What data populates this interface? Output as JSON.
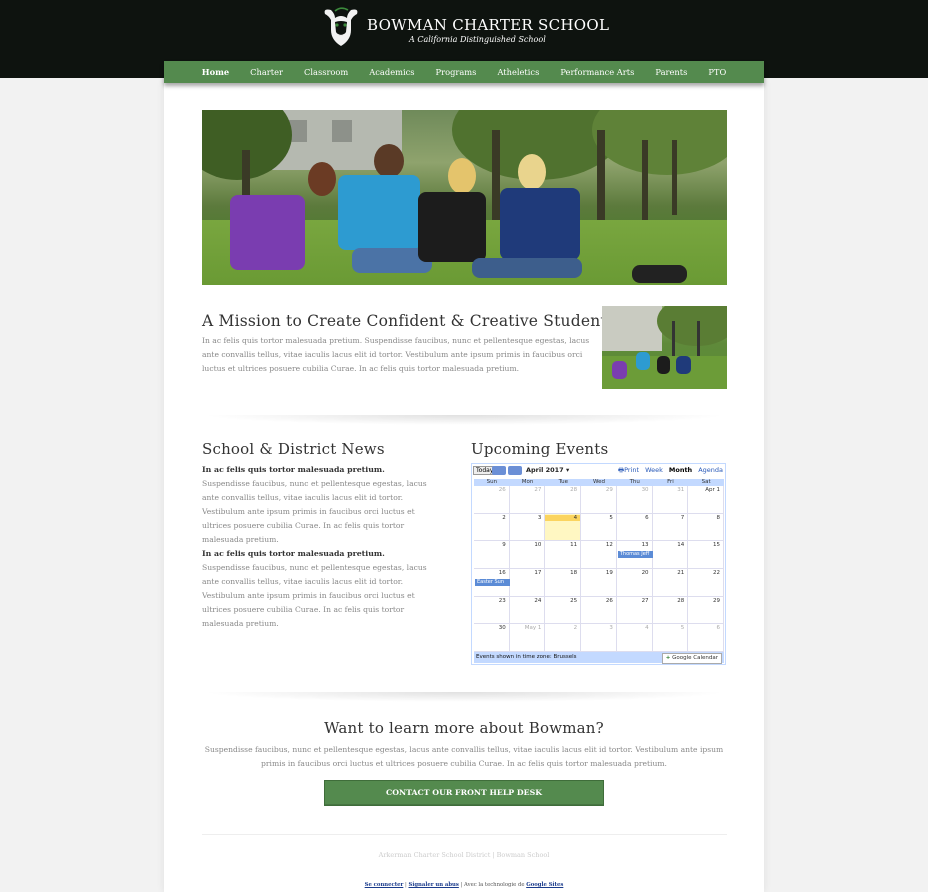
{
  "header": {
    "brand": "BOWMAN CHARTER SCHOOL",
    "tagline": "A California Distinguished School",
    "logo_icon": "bull-logo-icon"
  },
  "nav": {
    "items": [
      {
        "label": "Home"
      },
      {
        "label": "Charter"
      },
      {
        "label": "Classroom"
      },
      {
        "label": "Academics"
      },
      {
        "label": "Programs"
      },
      {
        "label": "Atheletics"
      },
      {
        "label": "Performance Arts"
      },
      {
        "label": "Parents"
      },
      {
        "label": "PTO"
      }
    ],
    "active": "Home"
  },
  "mission": {
    "title": "A Mission to Create Confident & Creative Students",
    "text": "In ac felis quis tortor malesuada pretium. Suspendisse faucibus, nunc et pellentesque egestas, lacus ante convallis tellus, vitae iaculis lacus elit id tortor. Vestibulum ante ipsum primis in faucibus orci luctus et ultrices posuere cubilia Curae. In ac felis quis tortor malesuada pretium."
  },
  "news": {
    "title": "School & District News",
    "items": [
      {
        "heading": "In ac felis quis tortor malesuada pretium.",
        "text": "Suspendisse faucibus, nunc et pellentesque egestas, lacus ante convallis tellus, vitae iaculis lacus elit id tortor. Vestibulum ante ipsum primis in faucibus orci luctus et ultrices posuere cubilia Curae. In ac felis quis tortor malesuada pretium."
      },
      {
        "heading": "In ac felis quis tortor malesuada pretium.",
        "text": "Suspendisse faucibus, nunc et pellentesque egestas, lacus ante convallis tellus, vitae iaculis lacus elit id tortor. Vestibulum ante ipsum primis in faucibus orci luctus et ultrices posuere cubilia Curae. In ac felis quis tortor malesuada pretium."
      }
    ]
  },
  "events": {
    "title": "Upcoming Events",
    "calendar": {
      "today_label": "Today",
      "month_label": "April 2017",
      "print_label": "Print",
      "tabs": [
        "Week",
        "Month",
        "Agenda"
      ],
      "selected_tab": "Month",
      "weekdays": [
        "Sun",
        "Mon",
        "Tue",
        "Wed",
        "Thu",
        "Fri",
        "Sat"
      ],
      "weeks": [
        [
          "26",
          "27",
          "28",
          "29",
          "30",
          "31",
          "Apr 1"
        ],
        [
          "2",
          "3",
          "4",
          "5",
          "6",
          "7",
          "8"
        ],
        [
          "9",
          "10",
          "11",
          "12",
          "13",
          "14",
          "15"
        ],
        [
          "16",
          "17",
          "18",
          "19",
          "20",
          "21",
          "22"
        ],
        [
          "23",
          "24",
          "25",
          "26",
          "27",
          "28",
          "29"
        ],
        [
          "30",
          "May 1",
          "2",
          "3",
          "4",
          "5",
          "6"
        ]
      ],
      "today_date": "4",
      "events": [
        {
          "label": "Thomas Jeff",
          "week": 2,
          "day": 4
        },
        {
          "label": "Easter Sun",
          "week": 3,
          "day": 0
        }
      ],
      "timezone_note": "Events shown in time zone: Brussels",
      "gc_label": "Google Calendar"
    }
  },
  "learn": {
    "title": "Want to learn more about Bowman?",
    "text": "Suspendisse faucibus, nunc et pellentesque egestas, lacus ante convallis tellus, vitae iaculis lacus elit id tortor. Vestibulum ante ipsum primis in faucibus orci luctus et ultrices posuere cubilia Curae. In ac felis quis tortor malesuada pretium.",
    "cta": "CONTACT OUR FRONT HELP DESK"
  },
  "footer": {
    "credits": "Arkerman Charter School District  |  Bowman School",
    "links": {
      "signin": "Se connecter",
      "sep1": " | ",
      "report": "Signaler un abus",
      "sep2": " | Avec la technologie de ",
      "sites": "Google Sites"
    }
  },
  "colors": {
    "header_bg": "#0e130f",
    "accent_green": "#548a4e",
    "calendar_blue": "#c3d9ff",
    "today_yellow": "#fbd45f"
  }
}
